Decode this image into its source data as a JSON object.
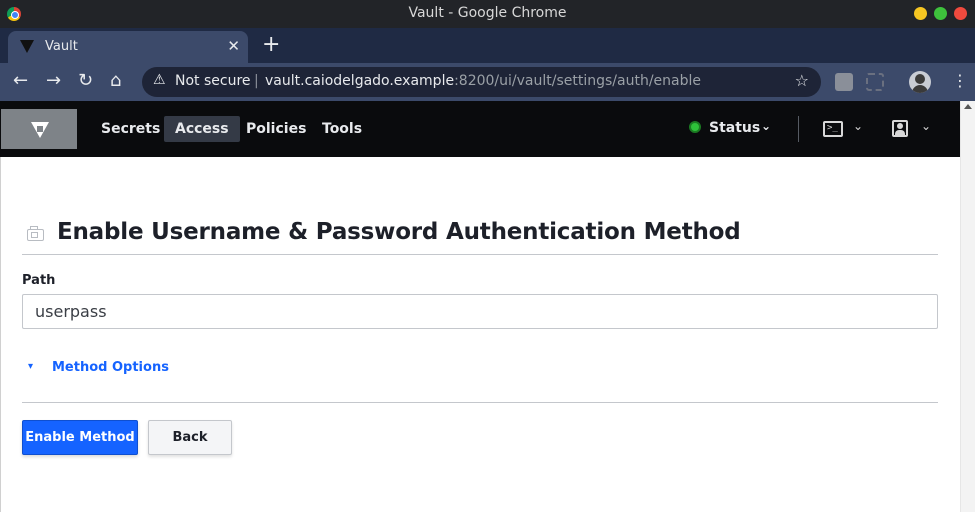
{
  "window": {
    "title": "Vault - Google Chrome",
    "controls_colors": {
      "minimize": "#f6c622",
      "maximize": "#3ec23c",
      "close": "#f04a3e"
    }
  },
  "tab": {
    "title": "Vault",
    "close": "✕",
    "new_tab": "+"
  },
  "toolbar": {
    "security_label": "Not secure",
    "separator": "|",
    "url_host": "vault.caiodelgado.example",
    "url_rest": ":8200/ui/vault/settings/auth/enable"
  },
  "vault_nav": {
    "items": [
      {
        "label": "Secrets"
      },
      {
        "label": "Access"
      },
      {
        "label": "Policies"
      },
      {
        "label": "Tools"
      }
    ],
    "status_label": "Status",
    "console_glyph": ">_"
  },
  "page": {
    "title": "Enable Username & Password Authentication Method",
    "path_label": "Path",
    "path_value": "userpass",
    "method_options_label": "Method Options",
    "enable_button": "Enable Method",
    "back_button": "Back"
  },
  "colors": {
    "accent": "#1563ff",
    "header_bg": "#0a0b0d",
    "status_ok": "#2ec23a"
  }
}
